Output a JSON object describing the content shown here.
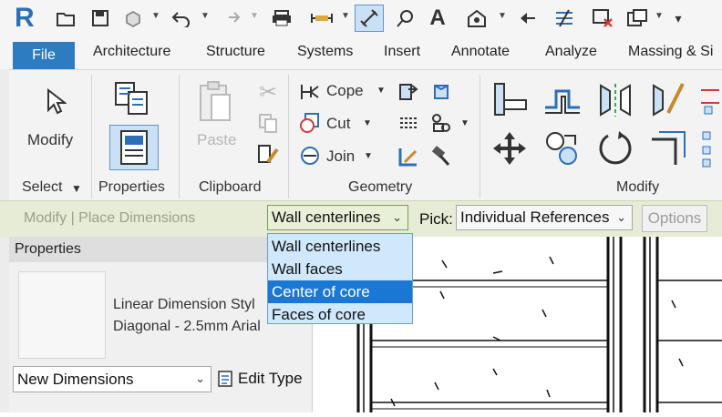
{
  "quick_access": {
    "app_logo": "R",
    "icons": [
      "open-icon",
      "save-icon",
      "sync-icon",
      "undo-icon",
      "redo-icon",
      "print-icon",
      "measure-icon",
      "aligned-dimension-icon",
      "tag-icon",
      "text-icon",
      "3d-view-icon",
      "section-icon",
      "thin-lines-icon",
      "close-hidden-icon",
      "switch-windows-icon",
      "customize-icon"
    ]
  },
  "ribbon_tabs": [
    {
      "label": "File"
    },
    {
      "label": "Architecture"
    },
    {
      "label": "Structure"
    },
    {
      "label": "Systems"
    },
    {
      "label": "Insert"
    },
    {
      "label": "Annotate"
    },
    {
      "label": "Analyze"
    },
    {
      "label": "Massing & Si"
    }
  ],
  "ribbon": {
    "select": {
      "modify_label": "Modify",
      "panel_label": "Select"
    },
    "properties": {
      "panel_label": "Properties"
    },
    "clipboard": {
      "paste_label": "Paste",
      "panel_label": "Clipboard"
    },
    "geometry": {
      "cope_label": "Cope",
      "cut_label": "Cut",
      "join_label": "Join",
      "panel_label": "Geometry"
    },
    "modify": {
      "panel_label": "Modify"
    }
  },
  "options_bar": {
    "context": "Modify | Place Dimensions",
    "reference_combo": "Wall centerlines",
    "pick_label": "Pick:",
    "pick_combo": "Individual References",
    "options_button": "Options"
  },
  "dropdown": {
    "items": [
      {
        "label": "Wall centerlines"
      },
      {
        "label": "Wall faces"
      },
      {
        "label": "Center of core"
      },
      {
        "label": "Faces of core"
      }
    ],
    "selected_index": 2
  },
  "properties_palette": {
    "title": "Properties",
    "type_line1": "Linear Dimension Styl",
    "type_line2": "Diagonal - 2.5mm Arial",
    "instance_combo": "New Dimensions",
    "edit_type_label": "Edit Type"
  },
  "colors": {
    "file_tab": "#2d7bc0",
    "options_bar": "#e7ecd6",
    "dropdown_bg": "#cfe8fb",
    "dropdown_selected": "#1a78d4"
  }
}
